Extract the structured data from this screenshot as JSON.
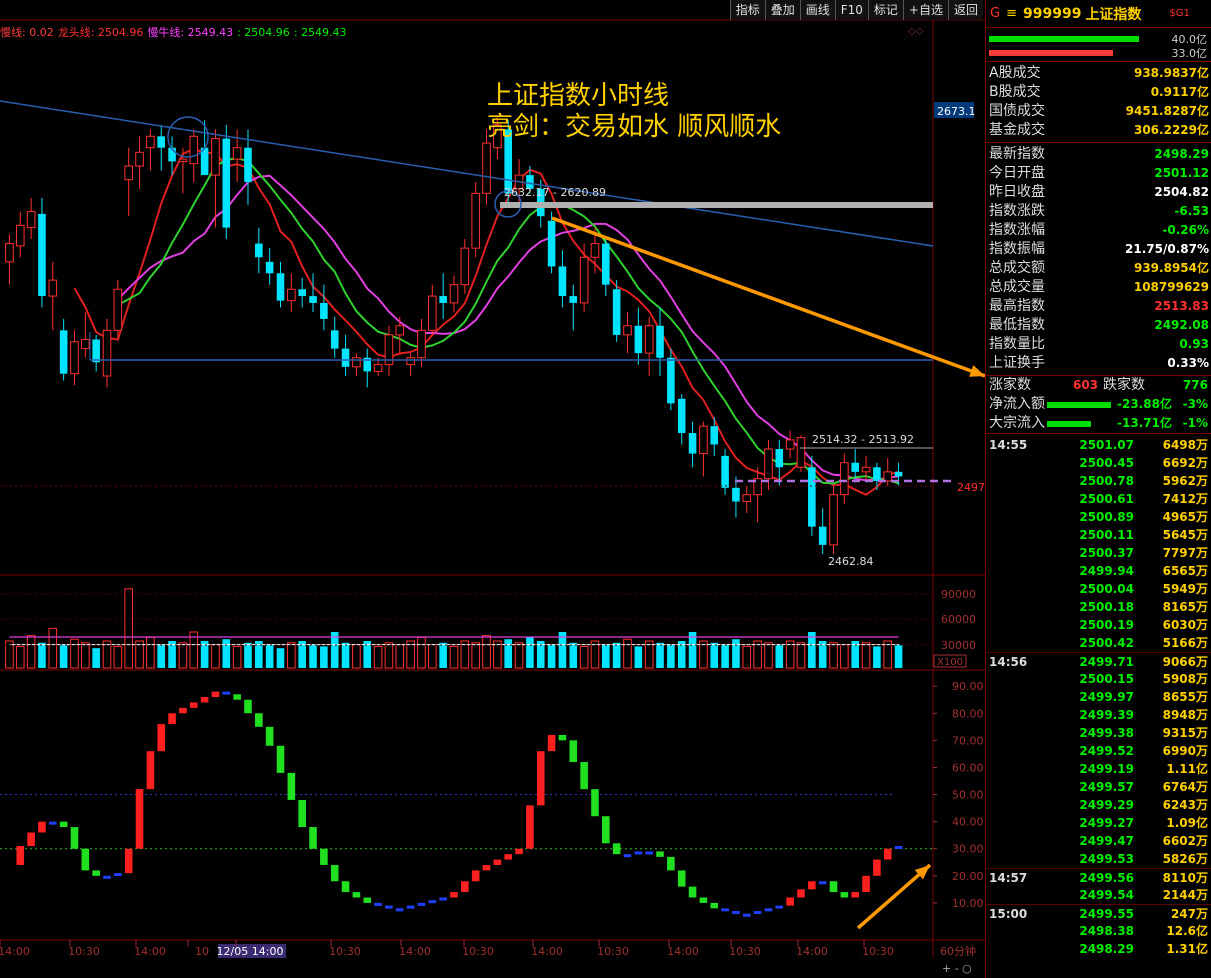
{
  "toolbar": [
    "指标",
    "叠加",
    "画线",
    "F10",
    "标记",
    "+自选",
    "返回"
  ],
  "ma_legend": [
    {
      "label": "慢线: 0.02",
      "color": "#ff4040"
    },
    {
      "label": "龙头线: 2504.96",
      "color": "#ff3030"
    },
    {
      "label": "慢牛线: 2549.43",
      "color": "#ff40ff"
    },
    {
      "label": ": 2504.96",
      "color": "#00ee00"
    },
    {
      "label": ": 2549.43",
      "color": "#00ee00"
    }
  ],
  "annotation": {
    "line1": "上证指数小时线",
    "line2": "亮剑：交易如水 顺风顺水"
  },
  "chart_data": {
    "type": "candlestick",
    "price_axis": {
      "min": 2455,
      "max": 2685
    },
    "right_price_tag": "2673.1",
    "current_tag": "2497",
    "labels": {
      "range_top": "2632.17 - 2620.89",
      "range_mid": "2514.32 - 2513.92",
      "low": "2462.84"
    },
    "candles": [
      [
        2590,
        2602,
        2580,
        2598
      ],
      [
        2597,
        2612,
        2592,
        2606
      ],
      [
        2605,
        2618,
        2600,
        2612
      ],
      [
        2611,
        2618,
        2570,
        2575
      ],
      [
        2575,
        2590,
        2560,
        2582
      ],
      [
        2560,
        2565,
        2538,
        2541
      ],
      [
        2541,
        2560,
        2536,
        2555
      ],
      [
        2552,
        2568,
        2548,
        2556
      ],
      [
        2556,
        2558,
        2542,
        2546
      ],
      [
        2540,
        2565,
        2535,
        2560
      ],
      [
        2560,
        2582,
        2556,
        2578
      ],
      [
        2626,
        2640,
        2610,
        2632
      ],
      [
        2632,
        2645,
        2622,
        2638
      ],
      [
        2640,
        2648,
        2630,
        2645
      ],
      [
        2645,
        2650,
        2630,
        2640
      ],
      [
        2640,
        2645,
        2628,
        2634
      ],
      [
        2634,
        2640,
        2620,
        2635
      ],
      [
        2633,
        2648,
        2625,
        2645
      ],
      [
        2640,
        2652,
        2630,
        2628
      ],
      [
        2628,
        2648,
        2605,
        2644
      ],
      [
        2644,
        2650,
        2600,
        2605
      ],
      [
        2635,
        2648,
        2625,
        2640
      ],
      [
        2640,
        2648,
        2615,
        2625
      ],
      [
        2598,
        2605,
        2585,
        2592
      ],
      [
        2590,
        2596,
        2580,
        2585
      ],
      [
        2585,
        2590,
        2570,
        2573
      ],
      [
        2573,
        2585,
        2568,
        2578
      ],
      [
        2578,
        2583,
        2570,
        2575
      ],
      [
        2575,
        2585,
        2568,
        2572
      ],
      [
        2572,
        2580,
        2560,
        2565
      ],
      [
        2560,
        2566,
        2548,
        2552
      ],
      [
        2552,
        2558,
        2540,
        2544
      ],
      [
        2544,
        2550,
        2540,
        2548
      ],
      [
        2548,
        2552,
        2535,
        2542
      ],
      [
        2542,
        2548,
        2540,
        2545
      ],
      [
        2545,
        2562,
        2540,
        2558
      ],
      [
        2558,
        2566,
        2550,
        2562
      ],
      [
        2545,
        2550,
        2540,
        2548
      ],
      [
        2548,
        2565,
        2544,
        2560
      ],
      [
        2560,
        2580,
        2558,
        2575
      ],
      [
        2575,
        2585,
        2565,
        2572
      ],
      [
        2572,
        2584,
        2568,
        2580
      ],
      [
        2580,
        2600,
        2576,
        2596
      ],
      [
        2596,
        2625,
        2592,
        2620
      ],
      [
        2620,
        2648,
        2615,
        2642
      ],
      [
        2640,
        2654,
        2635,
        2650
      ],
      [
        2648,
        2652,
        2615,
        2620
      ],
      [
        2622,
        2635,
        2616,
        2628
      ],
      [
        2628,
        2632,
        2620,
        2622
      ],
      [
        2622,
        2626,
        2605,
        2610
      ],
      [
        2608,
        2612,
        2585,
        2588
      ],
      [
        2588,
        2595,
        2570,
        2575
      ],
      [
        2575,
        2580,
        2560,
        2572
      ],
      [
        2572,
        2598,
        2568,
        2592
      ],
      [
        2592,
        2605,
        2585,
        2598
      ],
      [
        2598,
        2600,
        2575,
        2580
      ],
      [
        2578,
        2582,
        2555,
        2558
      ],
      [
        2558,
        2568,
        2550,
        2562
      ],
      [
        2562,
        2570,
        2545,
        2550
      ],
      [
        2550,
        2566,
        2540,
        2562
      ],
      [
        2562,
        2570,
        2540,
        2548
      ],
      [
        2548,
        2552,
        2525,
        2528
      ],
      [
        2530,
        2532,
        2510,
        2515
      ],
      [
        2515,
        2520,
        2500,
        2506
      ],
      [
        2506,
        2520,
        2496,
        2518
      ],
      [
        2518,
        2522,
        2505,
        2510
      ],
      [
        2505,
        2508,
        2488,
        2491
      ],
      [
        2491,
        2496,
        2478,
        2485
      ],
      [
        2485,
        2492,
        2480,
        2488
      ],
      [
        2488,
        2500,
        2476,
        2495
      ],
      [
        2495,
        2512,
        2490,
        2508
      ],
      [
        2508,
        2512,
        2492,
        2500
      ],
      [
        2508,
        2516,
        2504,
        2512
      ],
      [
        2500,
        2514,
        2498,
        2513
      ],
      [
        2500,
        2505,
        2470,
        2474
      ],
      [
        2474,
        2482,
        2462,
        2466
      ],
      [
        2466,
        2492,
        2462,
        2488
      ],
      [
        2488,
        2506,
        2484,
        2502
      ],
      [
        2502,
        2508,
        2495,
        2498
      ],
      [
        2498,
        2505,
        2494,
        2500
      ],
      [
        2500,
        2502,
        2490,
        2494
      ],
      [
        2494,
        2504,
        2492,
        2498
      ],
      [
        2498,
        2502,
        2492,
        2496
      ]
    ],
    "volume_axis": {
      "labels": [
        "90000",
        "60000",
        "30000",
        "X100"
      ]
    },
    "volume": [
      30,
      24,
      36,
      28,
      44,
      26,
      32,
      28,
      22,
      30,
      24,
      88,
      30,
      34,
      26,
      30,
      28,
      40,
      30,
      26,
      32,
      24,
      28,
      30,
      26,
      22,
      28,
      30,
      26,
      24,
      40,
      28,
      26,
      30,
      24,
      28,
      26,
      30,
      34,
      26,
      28,
      24,
      30,
      28,
      36,
      30,
      32,
      28,
      34,
      30,
      26,
      40,
      28,
      24,
      30,
      26,
      28,
      32,
      24,
      30,
      28,
      26,
      30,
      40,
      30,
      28,
      26,
      32,
      24,
      30,
      28,
      26,
      30,
      28,
      40,
      30,
      28,
      26,
      30,
      28,
      24,
      30,
      26
    ],
    "osc_axis": {
      "labels": [
        "90.00",
        "80.00",
        "70.00",
        "60.00",
        "50.00",
        "40.00",
        "30.00",
        "20.00",
        "10.00"
      ]
    },
    "oscillator": [
      24,
      31,
      36,
      40,
      40,
      38,
      30,
      22,
      20,
      20,
      21,
      30,
      52,
      66,
      76,
      80,
      82,
      84,
      86,
      88,
      87,
      85,
      80,
      75,
      68,
      58,
      48,
      38,
      30,
      24,
      18,
      14,
      12,
      10,
      9,
      8,
      8,
      9,
      10,
      11,
      12,
      14,
      18,
      22,
      24,
      26,
      28,
      30,
      46,
      66,
      72,
      70,
      62,
      52,
      42,
      32,
      28,
      28,
      29,
      29,
      27,
      22,
      16,
      12,
      10,
      8,
      7,
      6,
      6,
      7,
      8,
      9,
      12,
      15,
      18,
      18,
      14,
      12,
      14,
      20,
      26,
      30,
      31
    ],
    "time_labels": [
      "14:00",
      "10:30",
      "14:00",
      "10",
      "12/05 14:00",
      "10:30",
      "14:00",
      "10:30",
      "14:00",
      "10:30",
      "14:00",
      "10:30",
      "14:00",
      "10:30",
      "60分钟"
    ]
  },
  "quote": {
    "header": {
      "prefix": "G",
      "menu": "≡",
      "code": "999999",
      "name": "上证指数",
      "tag": "$G1"
    },
    "bars": [
      {
        "value": "40.0亿",
        "color": "#00dd00"
      },
      {
        "value": "33.0亿",
        "color": "#ff3a3a"
      }
    ],
    "group1": [
      {
        "label": "A股成交",
        "value": "938.9837亿",
        "color": "#ffd000"
      },
      {
        "label": "B股成交",
        "value": "0.9117亿",
        "color": "#ffd000"
      },
      {
        "label": "国债成交",
        "value": "9451.8287亿",
        "color": "#ffd000"
      },
      {
        "label": "基金成交",
        "value": "306.2229亿",
        "color": "#ffd000"
      }
    ],
    "group2": [
      {
        "label": "最新指数",
        "value": "2498.29",
        "color": "#00ee00"
      },
      {
        "label": "今日开盘",
        "value": "2501.12",
        "color": "#00ee00"
      },
      {
        "label": "昨日收盘",
        "value": "2504.82",
        "color": "#ffffff"
      },
      {
        "label": "指数涨跌",
        "value": "-6.53",
        "color": "#00ee00"
      },
      {
        "label": "指数涨幅",
        "value": "-0.26%",
        "color": "#00ee00"
      },
      {
        "label": "指数振幅",
        "value": "21.75/0.87%",
        "color": "#ffffff"
      },
      {
        "label": "总成交额",
        "value": "939.8954亿",
        "color": "#ffd000"
      },
      {
        "label": "总成交量",
        "value": "108799629",
        "color": "#ffd000"
      },
      {
        "label": "最高指数",
        "value": "2513.83",
        "color": "#ff3030"
      },
      {
        "label": "最低指数",
        "value": "2492.08",
        "color": "#00ee00"
      },
      {
        "label": "指数量比",
        "value": "0.93",
        "color": "#00ee00"
      },
      {
        "label": "上证换手",
        "value": "0.33%",
        "color": "#ffffff"
      }
    ],
    "updown": {
      "up_label": "涨家数",
      "up_value": "603",
      "down_label": "跌家数",
      "down_value": "776"
    },
    "flows": [
      {
        "label": "净流入额",
        "value": "-23.88亿",
        "pct": "-3%"
      },
      {
        "label": "大宗流入",
        "value": "-13.71亿",
        "pct": "-1%"
      }
    ],
    "ticks": [
      {
        "t": "14:55",
        "p": "2501.07",
        "v": "6498万"
      },
      {
        "t": "",
        "p": "2500.45",
        "v": "6692万"
      },
      {
        "t": "",
        "p": "2500.78",
        "v": "5962万"
      },
      {
        "t": "",
        "p": "2500.61",
        "v": "7412万"
      },
      {
        "t": "",
        "p": "2500.89",
        "v": "4965万"
      },
      {
        "t": "",
        "p": "2500.11",
        "v": "5645万"
      },
      {
        "t": "",
        "p": "2500.37",
        "v": "7797万"
      },
      {
        "t": "",
        "p": "2499.94",
        "v": "6565万"
      },
      {
        "t": "",
        "p": "2500.04",
        "v": "5949万"
      },
      {
        "t": "",
        "p": "2500.18",
        "v": "8165万"
      },
      {
        "t": "",
        "p": "2500.19",
        "v": "6030万"
      },
      {
        "t": "",
        "p": "2500.42",
        "v": "5166万"
      },
      {
        "t": "14:56",
        "p": "2499.71",
        "v": "9066万"
      },
      {
        "t": "",
        "p": "2500.15",
        "v": "5908万"
      },
      {
        "t": "",
        "p": "2499.97",
        "v": "8655万"
      },
      {
        "t": "",
        "p": "2499.39",
        "v": "8948万"
      },
      {
        "t": "",
        "p": "2499.38",
        "v": "9315万"
      },
      {
        "t": "",
        "p": "2499.52",
        "v": "6990万"
      },
      {
        "t": "",
        "p": "2499.19",
        "v": "1.11亿"
      },
      {
        "t": "",
        "p": "2499.57",
        "v": "6764万"
      },
      {
        "t": "",
        "p": "2499.29",
        "v": "6243万"
      },
      {
        "t": "",
        "p": "2499.27",
        "v": "1.09亿"
      },
      {
        "t": "",
        "p": "2499.47",
        "v": "6602万"
      },
      {
        "t": "",
        "p": "2499.53",
        "v": "5826万"
      },
      {
        "t": "14:57",
        "p": "2499.56",
        "v": "8110万"
      },
      {
        "t": "",
        "p": "2499.54",
        "v": "2144万"
      },
      {
        "t": "15:00",
        "p": "2499.55",
        "v": "247万"
      },
      {
        "t": "",
        "p": "2498.38",
        "v": "12.6亿"
      },
      {
        "t": "",
        "p": "2498.29",
        "v": "1.31亿"
      }
    ]
  }
}
